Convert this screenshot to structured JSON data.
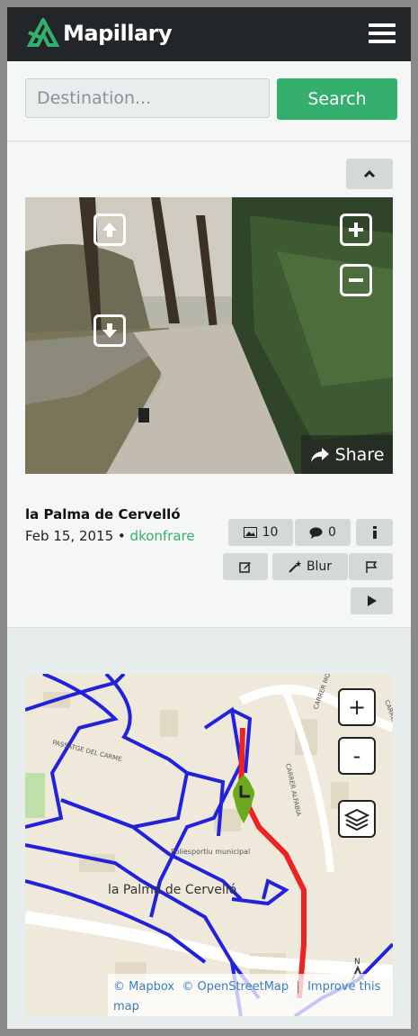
{
  "header": {
    "brand": "Mapillary",
    "logo_icon": "mapillary-logo-icon",
    "menu_icon": "hamburger-menu-icon"
  },
  "search": {
    "placeholder": "Destination...",
    "value": "",
    "button_label": "Search"
  },
  "viewer": {
    "collapse_icon": "chevron-up-icon",
    "share_label": "Share",
    "title": "la Palma de Cervelló",
    "date": "Feb 15, 2015",
    "separator": "•",
    "user": "dkonfrare",
    "actions": {
      "photos_count": "10",
      "comments_count": "0",
      "blur_label": "Blur"
    }
  },
  "map": {
    "place_label": "la Palma de Cervelló",
    "street_labels": [
      "PASSATGE DEL CARME",
      "CARRER ALFABIA",
      "CARRER MONTGRIS",
      "CARRER ROSSE"
    ],
    "poi_label": "Poliesportiu municipal",
    "zoom_in": "+",
    "zoom_out": "-",
    "attribution": {
      "mapbox": "© Mapbox",
      "osm": "© OpenStreetMap",
      "improve": "Improve this map"
    },
    "colors": {
      "sequence": "#2222dd",
      "current_sequence": "#ee2222",
      "marker": "#6aa81e"
    }
  },
  "colors": {
    "brand_green": "#35af6d",
    "topbar": "#222628"
  }
}
